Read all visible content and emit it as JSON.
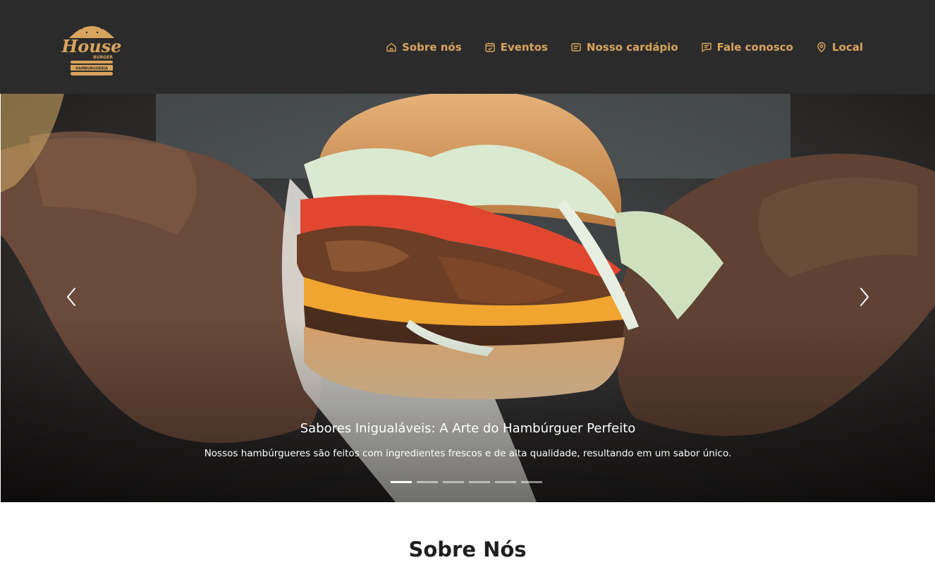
{
  "header": {
    "logo": {
      "main_text": "House",
      "sub_text": "BURGER",
      "tag_text": "HAMBURGUERIA",
      "colors": {
        "primary": "#d9a45d",
        "background": "#2b2b2b"
      }
    },
    "nav": [
      {
        "label": "Sobre nós",
        "icon": "home-icon"
      },
      {
        "label": "Eventos",
        "icon": "calendar-check-icon"
      },
      {
        "label": "Nosso cardápio",
        "icon": "menu-card-icon"
      },
      {
        "label": "Fale conosco",
        "icon": "chat-icon"
      },
      {
        "label": "Local",
        "icon": "map-pin-icon"
      }
    ],
    "accent_color": "#d9a45d"
  },
  "carousel": {
    "title": "Sabores Inigualáveis: A Arte do Hambúrguer Perfeito",
    "text": "Nossos hambúrgueres são feitos com ingredientes frescos e de alta qualidade, resultando em um sabor único.",
    "prev_icon": "chevron-left-icon",
    "next_icon": "chevron-right-icon",
    "slide_count": 6,
    "active_index": 0
  },
  "section": {
    "title": "Sobre Nós"
  }
}
